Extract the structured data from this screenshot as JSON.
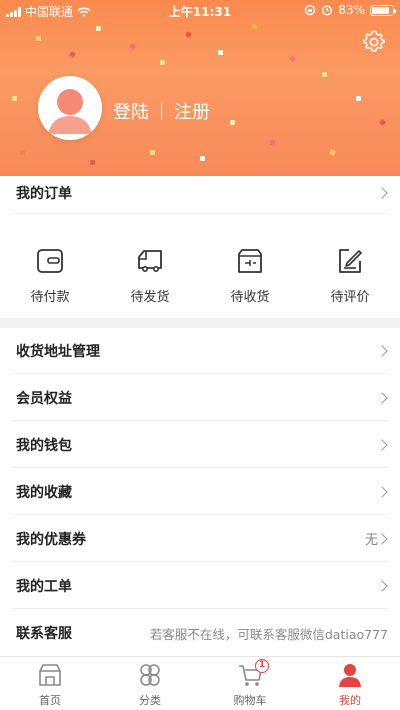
{
  "status": {
    "carrier": "中国联通",
    "time": "上午11:31",
    "battery": "83%",
    "battery_level": 0.83
  },
  "profile": {
    "login": "登陆",
    "register": "注册"
  },
  "orders_row": {
    "label": "我的订单"
  },
  "order_items": [
    {
      "label": "待付款",
      "icon": "wallet-icon"
    },
    {
      "label": "待发货",
      "icon": "truck-icon"
    },
    {
      "label": "待收货",
      "icon": "package-icon"
    },
    {
      "label": "待评价",
      "icon": "review-icon"
    }
  ],
  "menu": [
    {
      "label": "收货地址管理"
    },
    {
      "label": "会员权益"
    },
    {
      "label": "我的钱包"
    },
    {
      "label": "我的收藏"
    },
    {
      "label": "我的优惠券",
      "value": "无"
    },
    {
      "label": "我的工单"
    }
  ],
  "service": {
    "label": "联系客服",
    "hint": "若客服不在线，可联系客服微信datiao777"
  },
  "tabs": [
    {
      "label": "首页",
      "icon": "home-icon"
    },
    {
      "label": "分类",
      "icon": "category-icon"
    },
    {
      "label": "购物车",
      "icon": "cart-icon",
      "badge": "1"
    },
    {
      "label": "我的",
      "icon": "user-icon"
    }
  ],
  "colors": {
    "accent": "#e64340",
    "header_gradient_top": "#fb8a4e",
    "header_gradient_bottom": "#f78a5a"
  }
}
